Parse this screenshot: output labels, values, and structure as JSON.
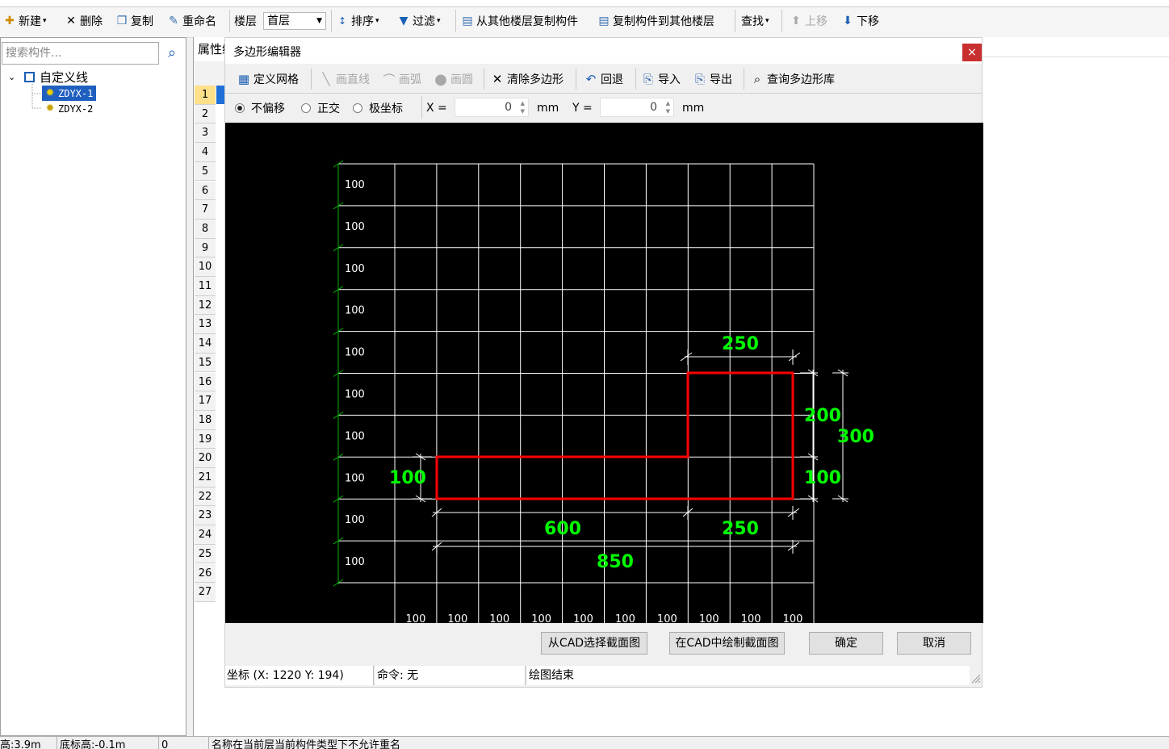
{
  "toolbar": {
    "new": "新建",
    "delete": "删除",
    "copy": "复制",
    "rename": "重命名",
    "floor_label": "楼层",
    "floor_value": "首层",
    "sort": "排序",
    "filter": "过滤",
    "copy_from_other": "从其他楼层复制构件",
    "copy_to_other": "复制构件到其他楼层",
    "find": "查找",
    "move_up": "上移",
    "move_down": "下移"
  },
  "left_panel": {
    "search_placeholder": "搜索构件...",
    "tree": {
      "root": "自定义线",
      "items": [
        "ZDYX-1",
        "ZDYX-2"
      ]
    }
  },
  "middle": {
    "properties_tab": "属性编"
  },
  "row_numbers": [
    "1",
    "2",
    "3",
    "4",
    "5",
    "6",
    "7",
    "8",
    "9",
    "10",
    "11",
    "12",
    "13",
    "14",
    "15",
    "16",
    "17",
    "18",
    "19",
    "20",
    "21",
    "22",
    "23",
    "24",
    "25",
    "26",
    "27"
  ],
  "dialog": {
    "title": "多边形编辑器",
    "close": "×",
    "toolbar": {
      "define_grid": "定义网格",
      "draw_line": "画直线",
      "draw_arc": "画弧",
      "draw_circle": "画圆",
      "clear_polygon": "清除多边形",
      "undo": "回退",
      "import": "导入",
      "export": "导出",
      "query_library": "查询多边形库"
    },
    "options": {
      "no_offset": "不偏移",
      "orthogonal": "正交",
      "polar": "极坐标",
      "x_label": "X =",
      "x_value": "0",
      "y_label": "Y =",
      "y_value": "0",
      "unit": "mm"
    },
    "canvas": {
      "grid_left_labels": [
        "100",
        "100",
        "100",
        "100",
        "100",
        "100",
        "100",
        "100",
        "100",
        "100"
      ],
      "grid_bottom_labels": [
        "100",
        "100",
        "100",
        "100",
        "100",
        "100",
        "100",
        "100",
        "100",
        "100"
      ],
      "dimensions": {
        "top_width": "250",
        "right_inner_upper": "200",
        "right_inner_lower": "100",
        "right_outer": "300",
        "left_height": "100",
        "bottom_left": "600",
        "bottom_right": "250",
        "bottom_total": "850"
      },
      "colors": {
        "background": "#000000",
        "grid": "#ffffff",
        "polygon": "#ff0000",
        "dimension_text": "#00ff00",
        "axis": "#00c000"
      }
    },
    "buttons": {
      "select_from_cad": "从CAD选择截面图",
      "draw_in_cad": "在CAD中绘制截面图",
      "ok": "确定",
      "cancel": "取消"
    },
    "status": {
      "coords": "坐标 (X: 1220 Y: 194)",
      "command": "命令: 无",
      "message": "绘图结束"
    }
  },
  "bottom_bar": {
    "field1": "高:3.9m",
    "field2": "底标高:-0.1m",
    "field3": "0",
    "message": "名称在当前层当前构件类型下不允许重名"
  }
}
